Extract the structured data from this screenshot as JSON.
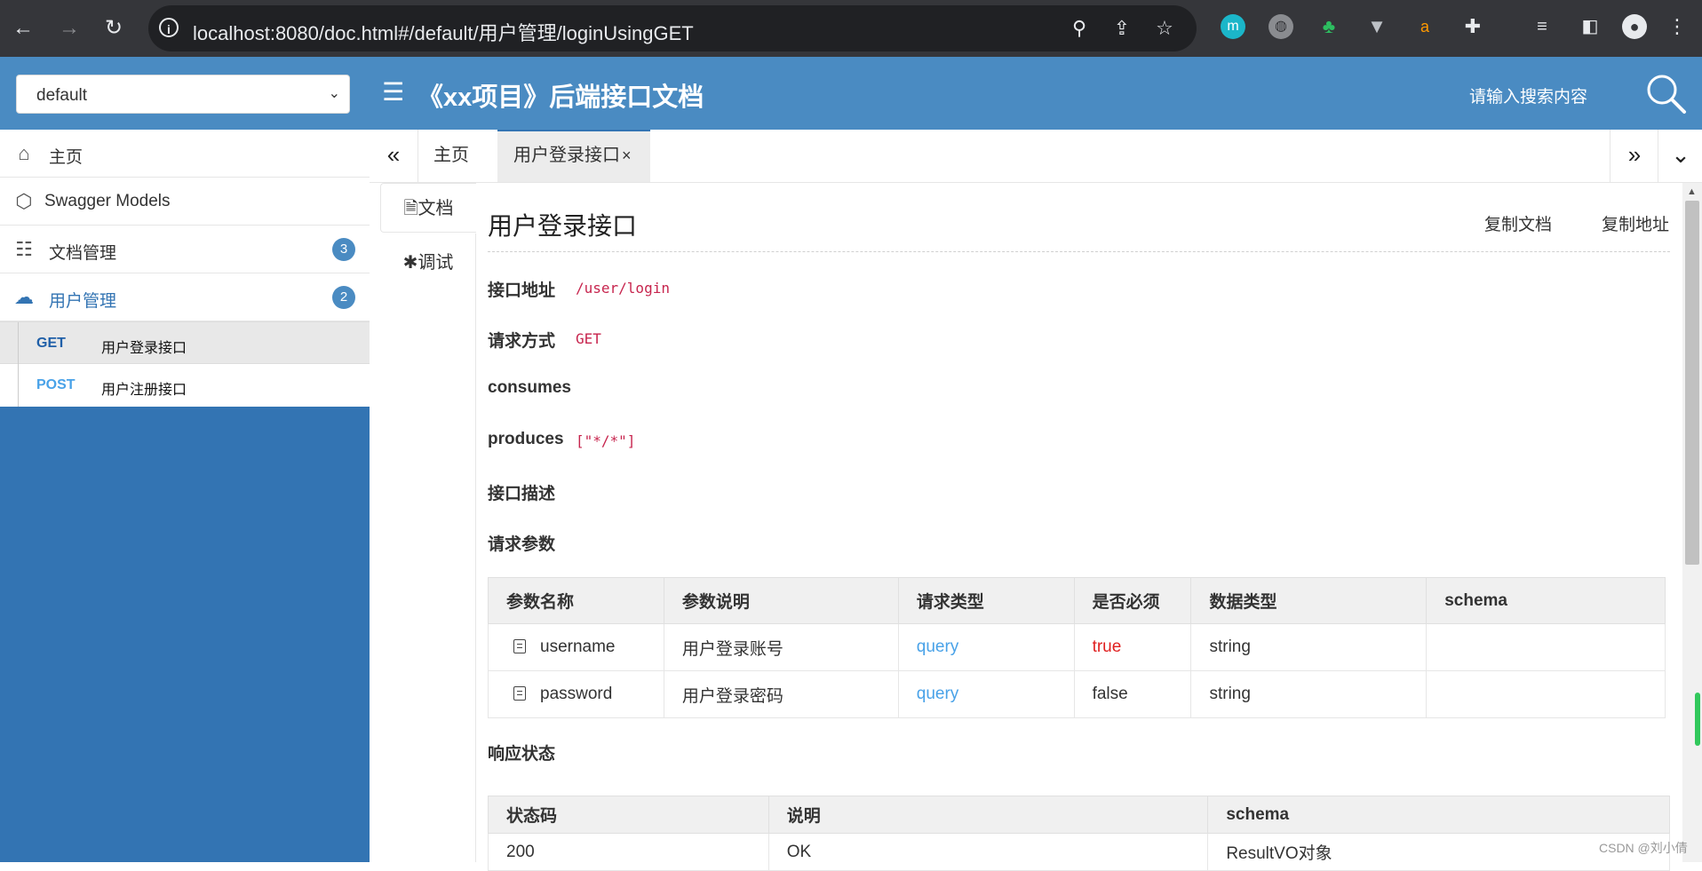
{
  "browser": {
    "url": "localhost:8080/doc.html#/default/用户管理/loginUsingGET"
  },
  "header": {
    "group_selected": "default",
    "title": "《xx项目》后端接口文档",
    "search_placeholder": "请输入搜索内容"
  },
  "sidebar": {
    "items": [
      {
        "label": "主页",
        "icon": "home-icon"
      },
      {
        "label": "Swagger Models",
        "icon": "models-icon"
      },
      {
        "label": "文档管理",
        "icon": "doc-settings-icon",
        "badge": "3"
      },
      {
        "label": "用户管理",
        "icon": "cloud-icon",
        "badge": "2"
      }
    ],
    "sub_items": [
      {
        "method": "GET",
        "label": "用户登录接口"
      },
      {
        "method": "POST",
        "label": "用户注册接口"
      }
    ]
  },
  "tabs": {
    "home": "主页",
    "active": "用户登录接口",
    "close_glyph": "×"
  },
  "side_tabs": {
    "doc": "文档",
    "debug": "调试"
  },
  "api": {
    "title": "用户登录接口",
    "copy_doc": "复制文档",
    "copy_address": "复制地址",
    "address_label": "接口地址",
    "address_value": "/user/login",
    "method_label": "请求方式",
    "method_value": "GET",
    "consumes_label": "consumes",
    "produces_label": "produces",
    "produces_value": "[\"*/*\"]",
    "description_label": "接口描述",
    "params_label": "请求参数",
    "params_headers": [
      "参数名称",
      "参数说明",
      "请求类型",
      "是否必须",
      "数据类型",
      "schema"
    ],
    "params_rows": [
      {
        "name": "username",
        "desc": "用户登录账号",
        "type": "query",
        "required": "true",
        "datatype": "string",
        "schema": ""
      },
      {
        "name": "password",
        "desc": "用户登录密码",
        "type": "query",
        "required": "false",
        "datatype": "string",
        "schema": ""
      }
    ],
    "response_label": "响应状态",
    "response_headers": [
      "状态码",
      "说明",
      "schema"
    ],
    "response_rows": [
      {
        "code": "200",
        "desc": "OK",
        "schema": "ResultVO对象"
      }
    ]
  },
  "watermark": "CSDN @刘小倩",
  "colors": {
    "header_blue": "#4a8bc2",
    "sidebar_blue": "#3374b3",
    "code_red": "#c7254e",
    "query_blue": "#49a2e8"
  }
}
